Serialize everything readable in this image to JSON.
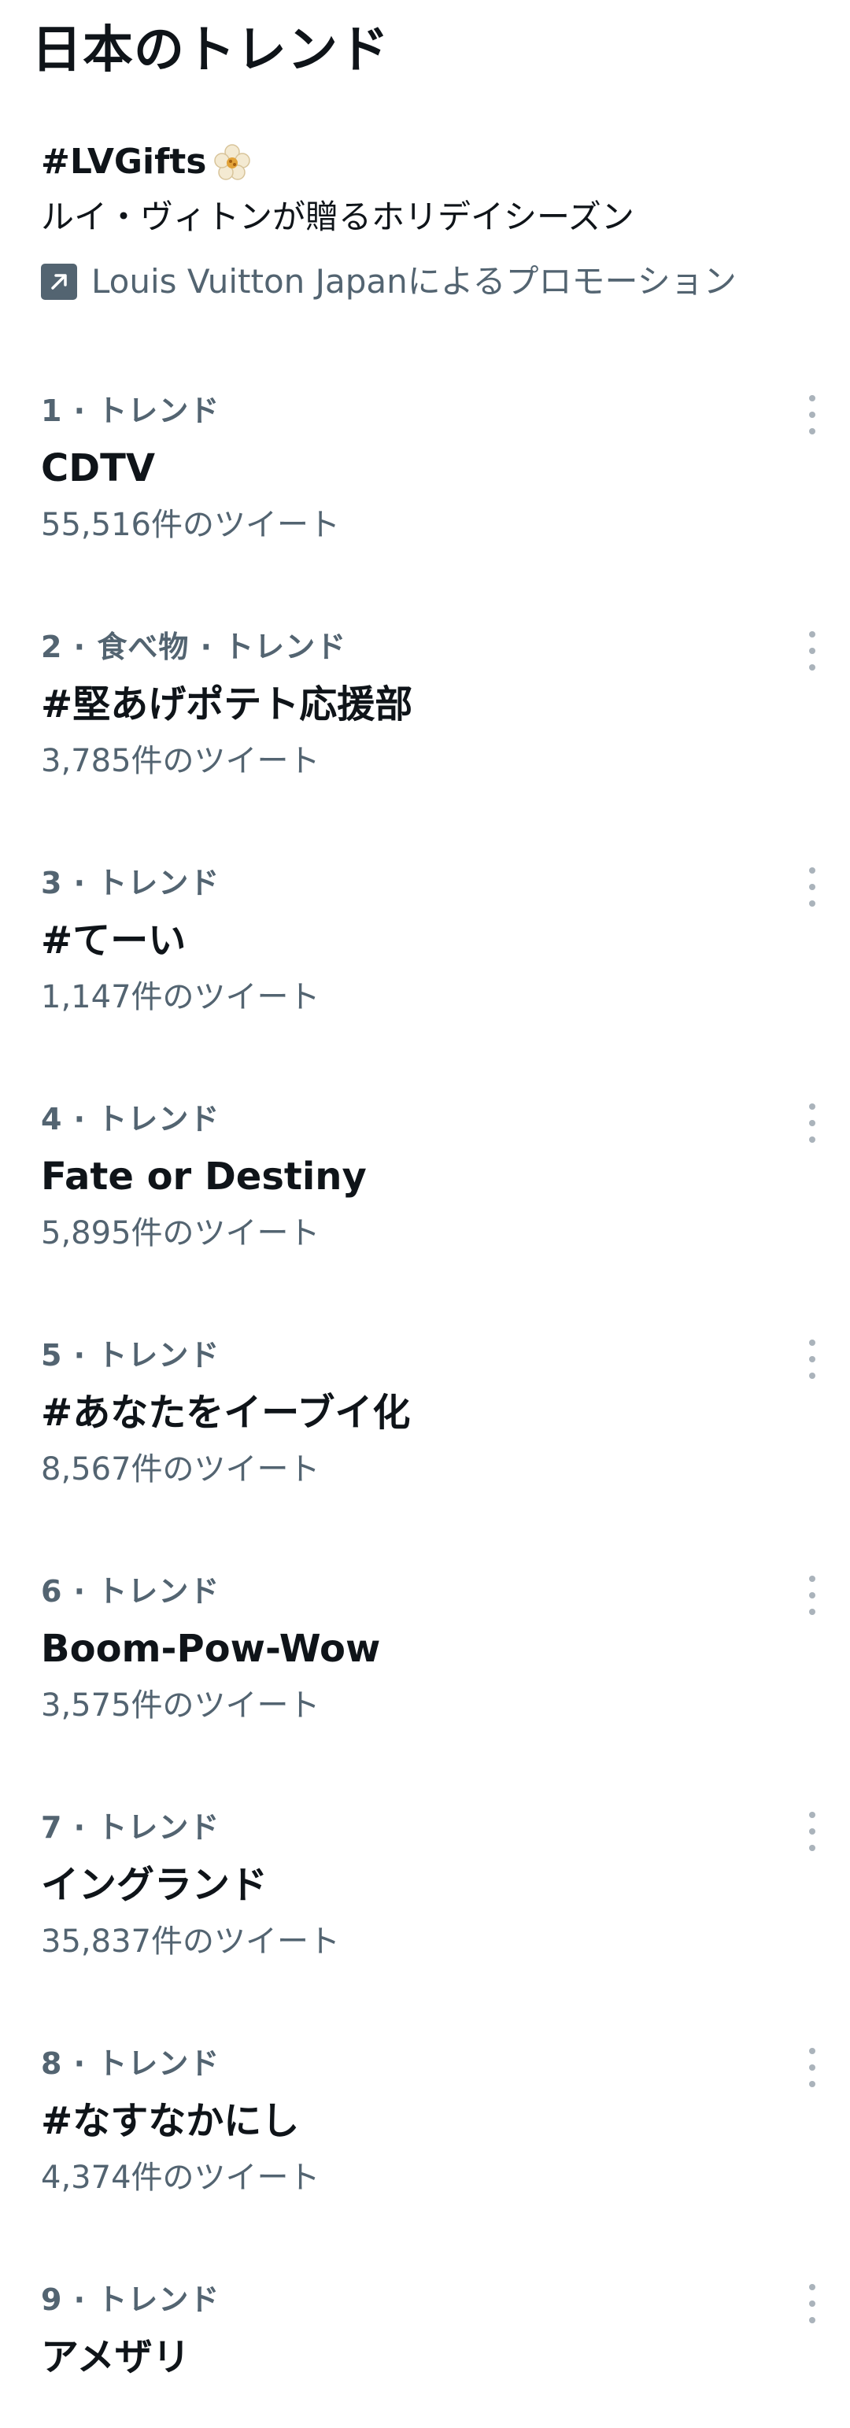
{
  "header": {
    "title": "日本のトレンド"
  },
  "promo": {
    "hashtag": "#LVGifts",
    "emoji_icon": "flower-emoji-icon",
    "description": "ルイ・ヴィトンが贈るホリデイシーズン",
    "promoted_by": "Louis Vuitton Japanによるプロモーション",
    "promoted_icon": "promoted-arrow-icon"
  },
  "trends": [
    {
      "meta": "1 · トレンド",
      "name": "CDTV",
      "count": "55,516件のツイート"
    },
    {
      "meta": "2 · 食べ物 · トレンド",
      "name": "#堅あげポテト応援部",
      "count": "3,785件のツイート"
    },
    {
      "meta": "3 · トレンド",
      "name": "#てーい",
      "count": "1,147件のツイート"
    },
    {
      "meta": "4 · トレンド",
      "name": "Fate or Destiny",
      "count": "5,895件のツイート"
    },
    {
      "meta": "5 · トレンド",
      "name": "#あなたをイーブイ化",
      "count": "8,567件のツイート"
    },
    {
      "meta": "6 · トレンド",
      "name": "Boom-Pow-Wow",
      "count": "3,575件のツイート"
    },
    {
      "meta": "7 · トレンド",
      "name": "イングランド",
      "count": "35,837件のツイート"
    },
    {
      "meta": "8 · トレンド",
      "name": "#なすなかにし",
      "count": "4,374件のツイート"
    },
    {
      "meta": "9 · トレンド",
      "name": "アメザリ",
      "count": ""
    }
  ],
  "colors": {
    "primary_text": "#0f1419",
    "secondary_text": "#536471",
    "icon_gray": "#aab3bb"
  }
}
